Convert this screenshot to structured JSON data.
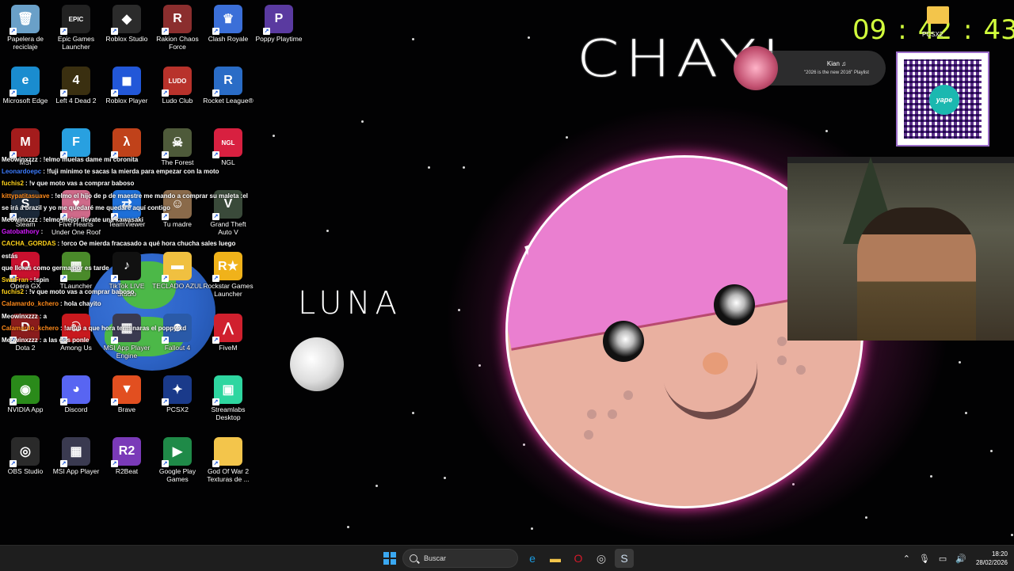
{
  "desktop": {
    "icons": [
      {
        "label": "Papelera de reciclaje",
        "glyph": "🗑",
        "color": "#6aa0c8"
      },
      {
        "label": "Epic Games Launcher",
        "glyph": "EPIC",
        "color": "#222222"
      },
      {
        "label": "Roblox Studio",
        "glyph": "◆",
        "color": "#2b2b2b"
      },
      {
        "label": "Rakion Chaos Force",
        "glyph": "R",
        "color": "#8b2e2e"
      },
      {
        "label": "Clash Royale",
        "glyph": "♛",
        "color": "#3b6fd8"
      },
      {
        "label": "Poppy Playtime",
        "glyph": "P",
        "color": "#5a3aa0"
      },
      {
        "label": "Microsoft Edge",
        "glyph": "e",
        "color": "#1a8ccf"
      },
      {
        "label": "Left 4 Dead 2",
        "glyph": "4",
        "color": "#3a2f10"
      },
      {
        "label": "Roblox Player",
        "glyph": "◼",
        "color": "#2257d8"
      },
      {
        "label": "Ludo Club",
        "glyph": "LUDO",
        "color": "#b8322b"
      },
      {
        "label": "Rocket League®",
        "glyph": "R",
        "color": "#2a6cc6"
      },
      {
        "label": "MSI",
        "glyph": "M",
        "color": "#a41c1c"
      },
      {
        "label": "",
        "glyph": "F",
        "color": "#28a0e0"
      },
      {
        "label": "",
        "glyph": "λ",
        "color": "#c0421a"
      },
      {
        "label": "The Forest",
        "glyph": "☠",
        "color": "#4e5a3a"
      },
      {
        "label": "NGL",
        "glyph": "NGL",
        "color": "#d82040"
      },
      {
        "label": "Steam",
        "glyph": "S",
        "color": "#1b2838"
      },
      {
        "label": "Five Hearts Under One Roof",
        "glyph": "♥",
        "color": "#cf6a8a"
      },
      {
        "label": "TeamViewer",
        "glyph": "⇄",
        "color": "#1e6fd8"
      },
      {
        "label": "Tu madre",
        "glyph": "☺",
        "color": "#8a6a4a"
      },
      {
        "label": "Grand Theft Auto V",
        "glyph": "V",
        "color": "#3a4a3a"
      },
      {
        "label": "Opera GX",
        "glyph": "O",
        "color": "#c8102e"
      },
      {
        "label": "TLauncher",
        "glyph": "▦",
        "color": "#4a8a2a"
      },
      {
        "label": "TikTok LIVE Studio",
        "glyph": "♪",
        "color": "#111111"
      },
      {
        "label": "TECLADO AZUL",
        "glyph": "▬",
        "color": "#f0c040"
      },
      {
        "label": "Rockstar Games Launcher",
        "glyph": "R★",
        "color": "#f0b21a"
      },
      {
        "label": "Dota 2",
        "glyph": "D",
        "color": "#8a1c1c"
      },
      {
        "label": "Among Us",
        "glyph": "ඞ",
        "color": "#c8191e"
      },
      {
        "label": "MSI App Player Engine",
        "glyph": "▦",
        "color": "#3a3a50"
      },
      {
        "label": "Fallout 4",
        "glyph": "☻",
        "color": "#2a5aa8"
      },
      {
        "label": "FiveM",
        "glyph": "⋀",
        "color": "#d0202e"
      },
      {
        "label": "NVIDIA App",
        "glyph": "◉",
        "color": "#2a8a1a"
      },
      {
        "label": "Discord",
        "glyph": "◕",
        "color": "#5865f2"
      },
      {
        "label": "Brave",
        "glyph": "▼",
        "color": "#e24f20"
      },
      {
        "label": "PCSX2",
        "glyph": "✦",
        "color": "#1a3a8a"
      },
      {
        "label": "Streamlabs Desktop",
        "glyph": "▣",
        "color": "#2ed6a0"
      },
      {
        "label": "OBS Studio",
        "glyph": "◎",
        "color": "#2a2a2a"
      },
      {
        "label": "MSI App Player",
        "glyph": "▦",
        "color": "#3a3a50"
      },
      {
        "label": "R2Beat",
        "glyph": "R2",
        "color": "#7a3ab8"
      },
      {
        "label": "Google Play Games",
        "glyph": "▶",
        "color": "#1f8a48"
      },
      {
        "label": "God Of War 2 Texturas de ...",
        "glyph": "",
        "color": "#f3c54b"
      }
    ],
    "folder_top_right": "PCSX2"
  },
  "chat": [
    {
      "user": "Meowinxzzz",
      "user_color": "#ffffff",
      "text": ": !elmo muelas dame mi coronita"
    },
    {
      "user": "Leonardoepc",
      "user_color": "#3c7cff",
      "text": ": !fuji minimo te sacas la mierda para empezar con la moto"
    },
    {
      "user": "fuchis2",
      "user_color": "#ffd21a",
      "text": ": !v que moto vas a comprar baboso"
    },
    {
      "user": "kittypatitasuave",
      "user_color": "#ff8a1a",
      "text": ": !elmo el hijo de p de maestre me mando a comprar su maleta :el"
    },
    {
      "user": "",
      "user_color": "#ffffff",
      "text": "se irá a brazil y yo me quedaré me quedaré aquí contigo"
    },
    {
      "user": "Meowinxzzz",
      "user_color": "#ffffff",
      "text": ": !elmo mejor llevate una kawasaki"
    },
    {
      "user": "Gatobathory",
      "user_color": "#d41aff",
      "text": ":"
    },
    {
      "user": "CACHA_GORDAS",
      "user_color": "#ffd21a",
      "text": ": !orco Oe mierda fracasado a qué hora chucha sales luego estás"
    },
    {
      "user": "",
      "user_color": "#ffffff",
      "text": "que lloras como germa por es tarde"
    },
    {
      "user": "SwnFran",
      "user_color": "#ffd21a",
      "text": ": !spin"
    },
    {
      "user": "fuchis2",
      "user_color": "#ffd21a",
      "text": ": !v que moto vas a comprar baboso"
    },
    {
      "user": "Calamardo_kchero",
      "user_color": "#ff8a1a",
      "text": ": hola chayito"
    },
    {
      "user": "Meowinxzzz",
      "user_color": "#ffffff",
      "text": ": a"
    },
    {
      "user": "Calamardo_kchero",
      "user_color": "#ff8a1a",
      "text": ": !anub a que hora terminaras el poppy xd"
    },
    {
      "user": "Meowinxzzz",
      "user_color": "#ffffff",
      "text": ": a las dos ponle"
    }
  ],
  "wallpaper": {
    "title_text": "CHAYI",
    "moon_label": "LUNA"
  },
  "clock": {
    "hours": "09",
    "sep1": ":",
    "minutes": "42",
    "sep2": ":",
    "seconds": "43"
  },
  "now_playing": {
    "name": "Kian ♫",
    "subtitle": "\"2026 is the new 2016\" Playlist"
  },
  "qr": {
    "logo_text": "yape"
  },
  "taskbar": {
    "search_placeholder": "Buscar",
    "time": "18:20",
    "date": "28/02/2026",
    "tray_icons": [
      "chevron-up-icon",
      "microphone-icon",
      "display-icon",
      "speaker-icon"
    ]
  }
}
